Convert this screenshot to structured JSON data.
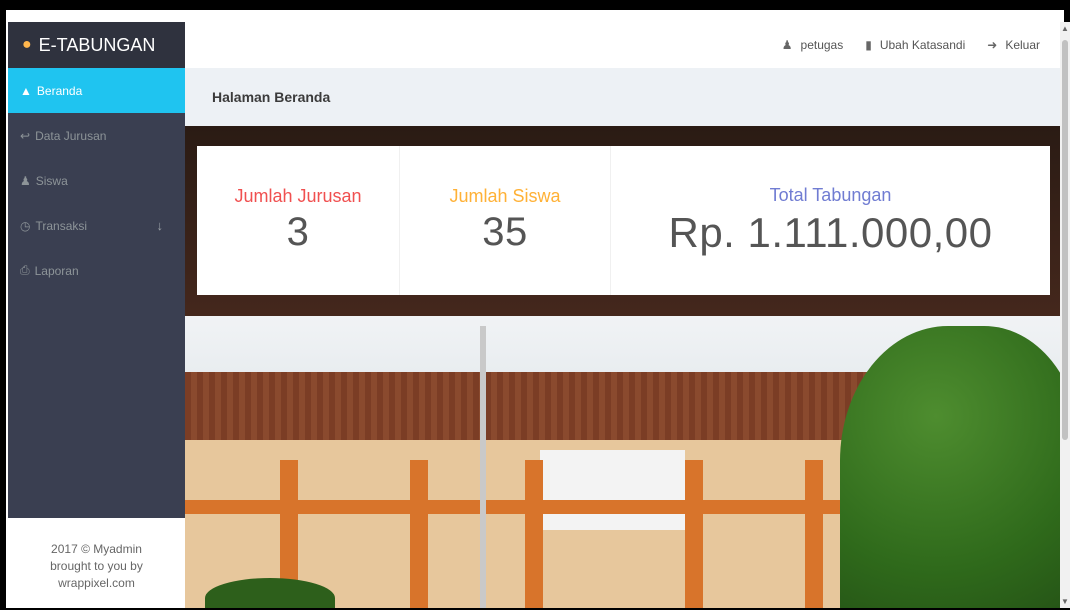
{
  "brand": {
    "name": "E-TABUNGAN"
  },
  "sidebar": {
    "items": [
      {
        "label": "Beranda",
        "icon": "flame-icon",
        "active": true
      },
      {
        "label": "Data Jurusan",
        "icon": "signpost-icon",
        "active": false
      },
      {
        "label": "Siswa",
        "icon": "user-icon",
        "active": false
      },
      {
        "label": "Transaksi",
        "icon": "clock-icon",
        "active": false,
        "has_submenu": true
      },
      {
        "label": "Laporan",
        "icon": "print-icon",
        "active": false
      }
    ],
    "footer": {
      "line1": "2017 © Myadmin",
      "line2": "brought to you by",
      "line3": "wrappixel.com"
    }
  },
  "topbar": {
    "user": "petugas",
    "change_password": "Ubah Katasandi",
    "logout": "Keluar"
  },
  "page": {
    "title": "Halaman Beranda"
  },
  "stats": [
    {
      "label": "Jumlah Jurusan",
      "value": "3",
      "color": "#f05050"
    },
    {
      "label": "Jumlah Siswa",
      "value": "35",
      "color": "#ffb136"
    },
    {
      "label": "Total Tabungan",
      "value": "Rp. 1.111.000,00",
      "color": "#707cd2"
    }
  ],
  "colors": {
    "accent": "#1fc4f0",
    "sidebar_bg": "#3a3f51",
    "brand_bg": "#2f323e"
  }
}
